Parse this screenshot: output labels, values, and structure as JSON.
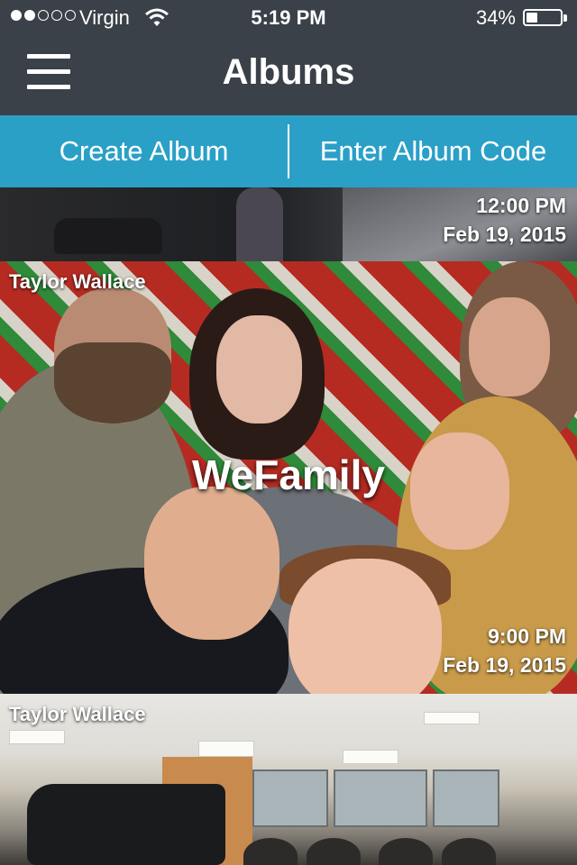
{
  "status_bar": {
    "carrier": "Virgin",
    "time": "5:19 PM",
    "battery_percent": "34%",
    "battery_level": 0.34,
    "signal_bars_filled": 2,
    "signal_bars_total": 5
  },
  "nav": {
    "title": "Albums",
    "menu_icon": "hamburger-menu-icon"
  },
  "actions": {
    "create_album": "Create Album",
    "enter_album_code": "Enter Album Code"
  },
  "colors": {
    "nav_background": "#3b4148",
    "action_bar": "#2aa0c7",
    "text": "#ffffff"
  },
  "albums": [
    {
      "owner": "",
      "title": "",
      "time": "12:00 PM",
      "date": "Feb 19, 2015"
    },
    {
      "owner": "Taylor Wallace",
      "title": "WeFamily",
      "time": "9:00 PM",
      "date": "Feb 19, 2015"
    },
    {
      "owner": "Taylor Wallace",
      "title": "",
      "time": "",
      "date": ""
    }
  ]
}
